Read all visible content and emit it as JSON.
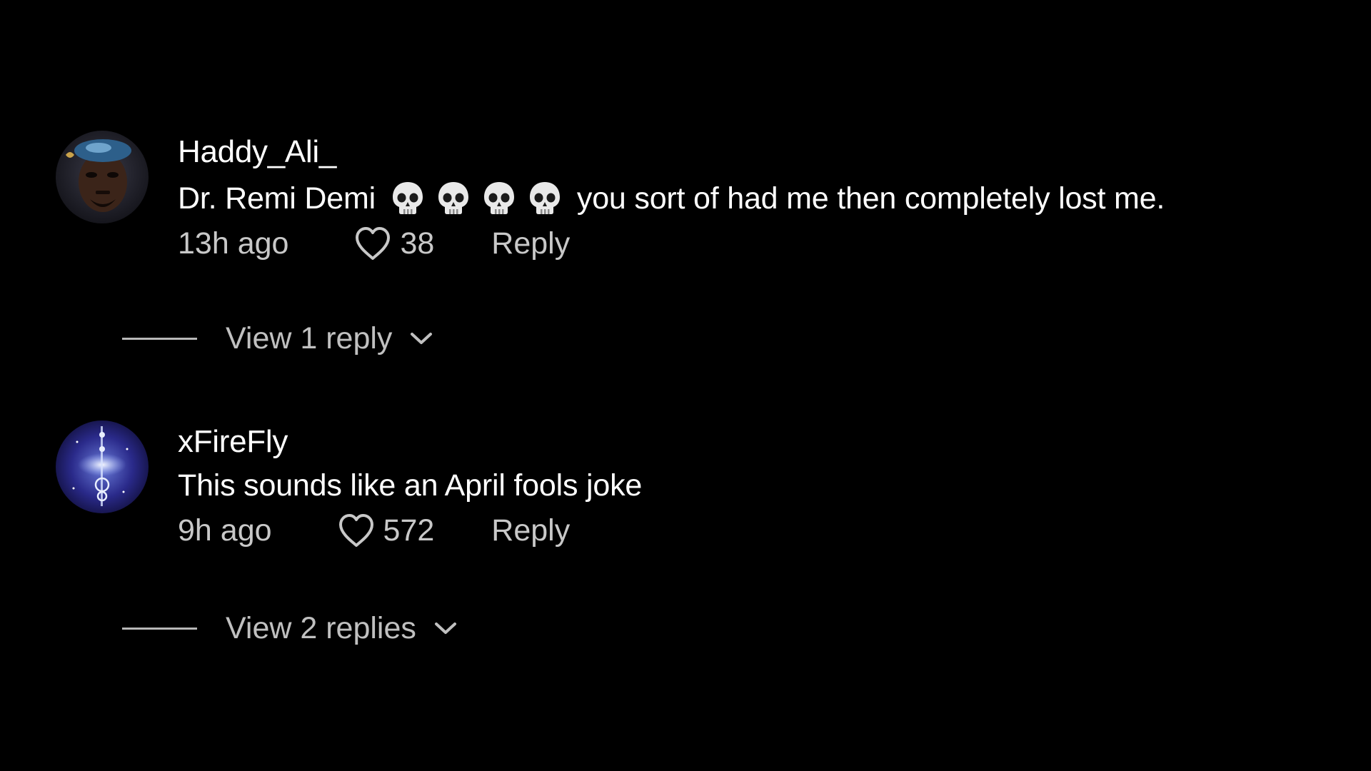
{
  "comments": [
    {
      "username": "Haddy_Ali_",
      "text_before": "Dr. Remi Demi",
      "emojis": [
        "skull-icon",
        "skull-icon",
        "skull-icon",
        "skull-icon"
      ],
      "text_after": "you sort of had me then completely lost me.",
      "time": "13h ago",
      "likes": "38",
      "reply_label": "Reply",
      "view_replies_label": "View 1 reply"
    },
    {
      "username": "xFireFly",
      "text": "This sounds like an April fools joke",
      "time": "9h ago",
      "likes": "572",
      "reply_label": "Reply",
      "view_replies_label": "View 2 replies"
    }
  ],
  "colors": {
    "background": "#000000",
    "primary_text": "#ffffff",
    "secondary_text": "#c8c8c8"
  },
  "icons": {
    "like": "heart-outline-icon",
    "expand": "chevron-down-icon"
  }
}
